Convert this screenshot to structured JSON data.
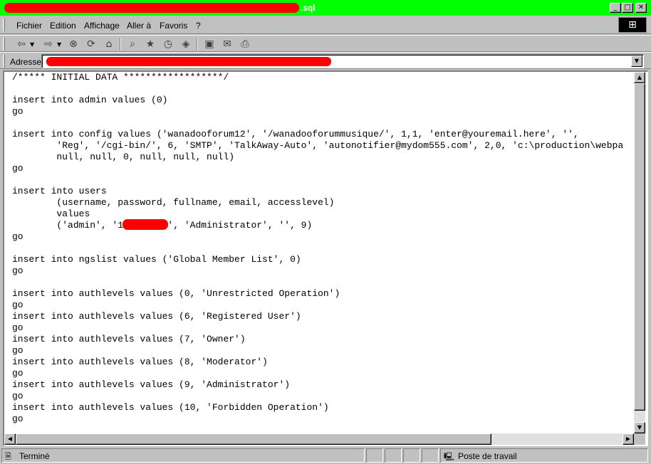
{
  "window": {
    "title_suffix": ".sql",
    "buttons": {
      "minimize": "_",
      "maximize": "□",
      "close": "✕"
    }
  },
  "menu": {
    "items": [
      "Fichier",
      "Edition",
      "Affichage",
      "Aller à",
      "Favoris",
      "?"
    ]
  },
  "toolbar": {
    "icons": [
      "back-icon",
      "forward-icon",
      "stop-icon",
      "refresh-icon",
      "home-icon",
      "search-icon",
      "favorites-icon",
      "history-icon",
      "channels-icon",
      "fullscreen-icon",
      "mail-icon",
      "print-icon"
    ]
  },
  "address": {
    "label": "Adresse"
  },
  "content": {
    "lines": [
      "/***** INITIAL DATA ******************/",
      "",
      "insert into admin values (0)",
      "go",
      "",
      "insert into config values ('wanadooforum12', '/wanadooforummusique/', 1,1, 'enter@youremail.here', '',",
      "        'Reg', '/cgi-bin/', 6, 'SMTP', 'TalkAway-Auto', 'autonotifier@mydom555.com', 2,0, 'c:\\production\\webpa",
      "        null, null, 0, null, null, null)",
      "go",
      "",
      "insert into users",
      "        (username, password, fullname, email, accesslevel)",
      "        values",
      "        ('admin', '1a      c', 'Administrator', '', 9)",
      "go",
      "",
      "insert into ngslist values ('Global Member List', 0)",
      "go",
      "",
      "insert into authlevels values (0, 'Unrestricted Operation')",
      "go",
      "insert into authlevels values (6, 'Registered User')",
      "go",
      "insert into authlevels values (7, 'Owner')",
      "go",
      "insert into authlevels values (8, 'Moderator')",
      "go",
      "insert into authlevels values (9, 'Administrator')",
      "go",
      "insert into authlevels values (10, 'Forbidden Operation')",
      "go"
    ]
  },
  "status": {
    "left_text": "Terminé",
    "zone_text": "Poste de travail"
  },
  "colors": {
    "titlebar": "#00ff00",
    "redaction": "#ff0000",
    "chrome": "#c0c0c0"
  }
}
